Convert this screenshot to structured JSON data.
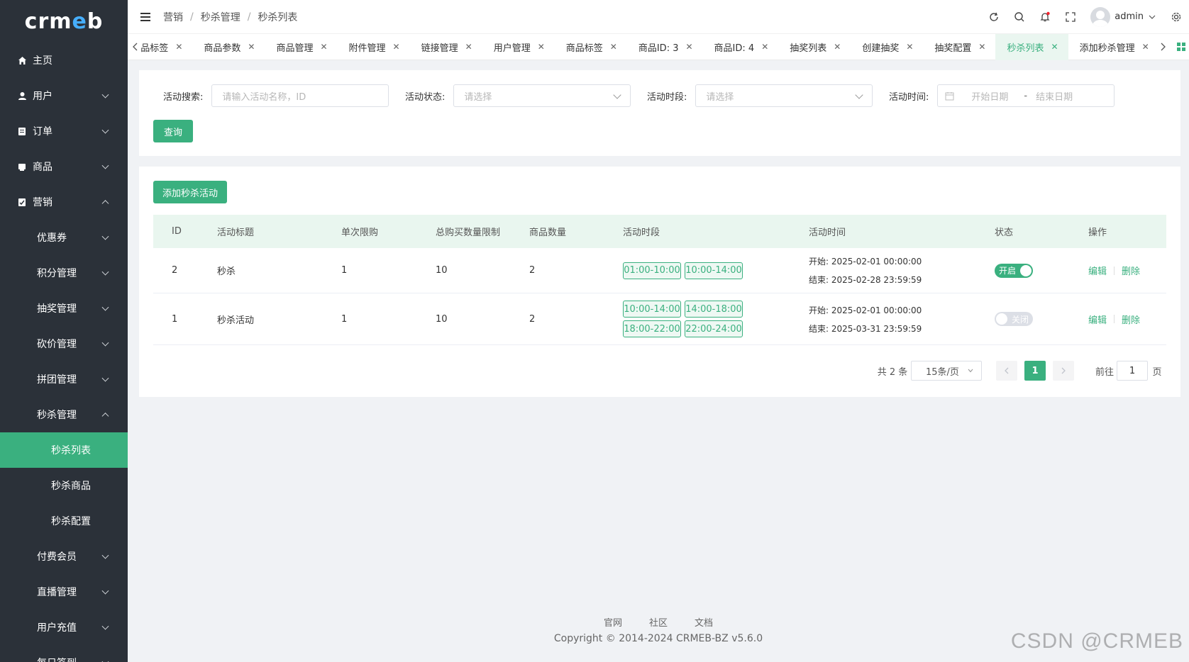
{
  "logo": "crmeb",
  "sidebar": {
    "items": [
      {
        "label": "主页"
      },
      {
        "label": "用户"
      },
      {
        "label": "订单"
      },
      {
        "label": "商品"
      },
      {
        "label": "营销"
      },
      {
        "label": "优惠券"
      },
      {
        "label": "积分管理"
      },
      {
        "label": "抽奖管理"
      },
      {
        "label": "砍价管理"
      },
      {
        "label": "拼团管理"
      },
      {
        "label": "秒杀管理"
      },
      {
        "label": "秒杀列表"
      },
      {
        "label": "秒杀商品"
      },
      {
        "label": "秒杀配置"
      },
      {
        "label": "付费会员"
      },
      {
        "label": "直播管理"
      },
      {
        "label": "用户充值"
      },
      {
        "label": "每日签到"
      }
    ]
  },
  "breadcrumb": [
    "营销",
    "秒杀管理",
    "秒杀列表"
  ],
  "header": {
    "username": "admin"
  },
  "tabs": [
    {
      "label": "品标签"
    },
    {
      "label": "商品参数"
    },
    {
      "label": "商品管理"
    },
    {
      "label": "附件管理"
    },
    {
      "label": "链接管理"
    },
    {
      "label": "用户管理"
    },
    {
      "label": "商品标签"
    },
    {
      "label": "商品ID: 3"
    },
    {
      "label": "商品ID: 4"
    },
    {
      "label": "抽奖列表"
    },
    {
      "label": "创建抽奖"
    },
    {
      "label": "抽奖配置"
    },
    {
      "label": "秒杀列表"
    },
    {
      "label": "添加秒杀管理"
    }
  ],
  "search": {
    "name_label": "活动搜索:",
    "name_placeholder": "请输入活动名称，ID",
    "status_label": "活动状态:",
    "status_placeholder": "请选择",
    "period_label": "活动时段:",
    "period_placeholder": "请选择",
    "time_label": "活动时间:",
    "start_placeholder": "开始日期",
    "range_sep": "-",
    "end_placeholder": "结束日期",
    "query_button": "查询"
  },
  "add_button": "添加秒杀活动",
  "table": {
    "headers": [
      "ID",
      "活动标题",
      "单次限购",
      "总购买数量限制",
      "商品数量",
      "活动时段",
      "活动时间",
      "状态",
      "操作"
    ],
    "rows": [
      {
        "id": "2",
        "title": "秒杀",
        "single_limit": "1",
        "total_limit": "10",
        "goods_count": "2",
        "slots": [
          "01:00-10:00",
          "10:00-14:00"
        ],
        "start": "开始: 2025-02-01 00:00:00",
        "end": "结束: 2025-02-28 23:59:59",
        "status_on": true,
        "status_label": "开启",
        "edit": "编辑",
        "delete": "删除"
      },
      {
        "id": "1",
        "title": "秒杀活动",
        "single_limit": "1",
        "total_limit": "10",
        "goods_count": "2",
        "slots": [
          "10:00-14:00",
          "14:00-18:00",
          "18:00-22:00",
          "22:00-24:00"
        ],
        "start": "开始: 2025-02-01 00:00:00",
        "end": "结束: 2025-03-31 23:59:59",
        "status_on": false,
        "status_label": "关闭",
        "edit": "编辑",
        "delete": "删除"
      }
    ]
  },
  "pagination": {
    "total": "共 2 条",
    "page_size": "15条/页",
    "current": "1",
    "goto_label": "前往",
    "goto_value": "1",
    "page_unit": "页"
  },
  "footer": {
    "links": [
      "官网",
      "社区",
      "文档"
    ],
    "copyright": "Copyright © 2014-2024 CRMEB-BZ v5.6.0"
  },
  "watermark": "CSDN @CRMEB",
  "colors": {
    "primary": "#3ab07f",
    "sidebar_bg": "#2b3139",
    "logo_accent": "#46aefc"
  }
}
